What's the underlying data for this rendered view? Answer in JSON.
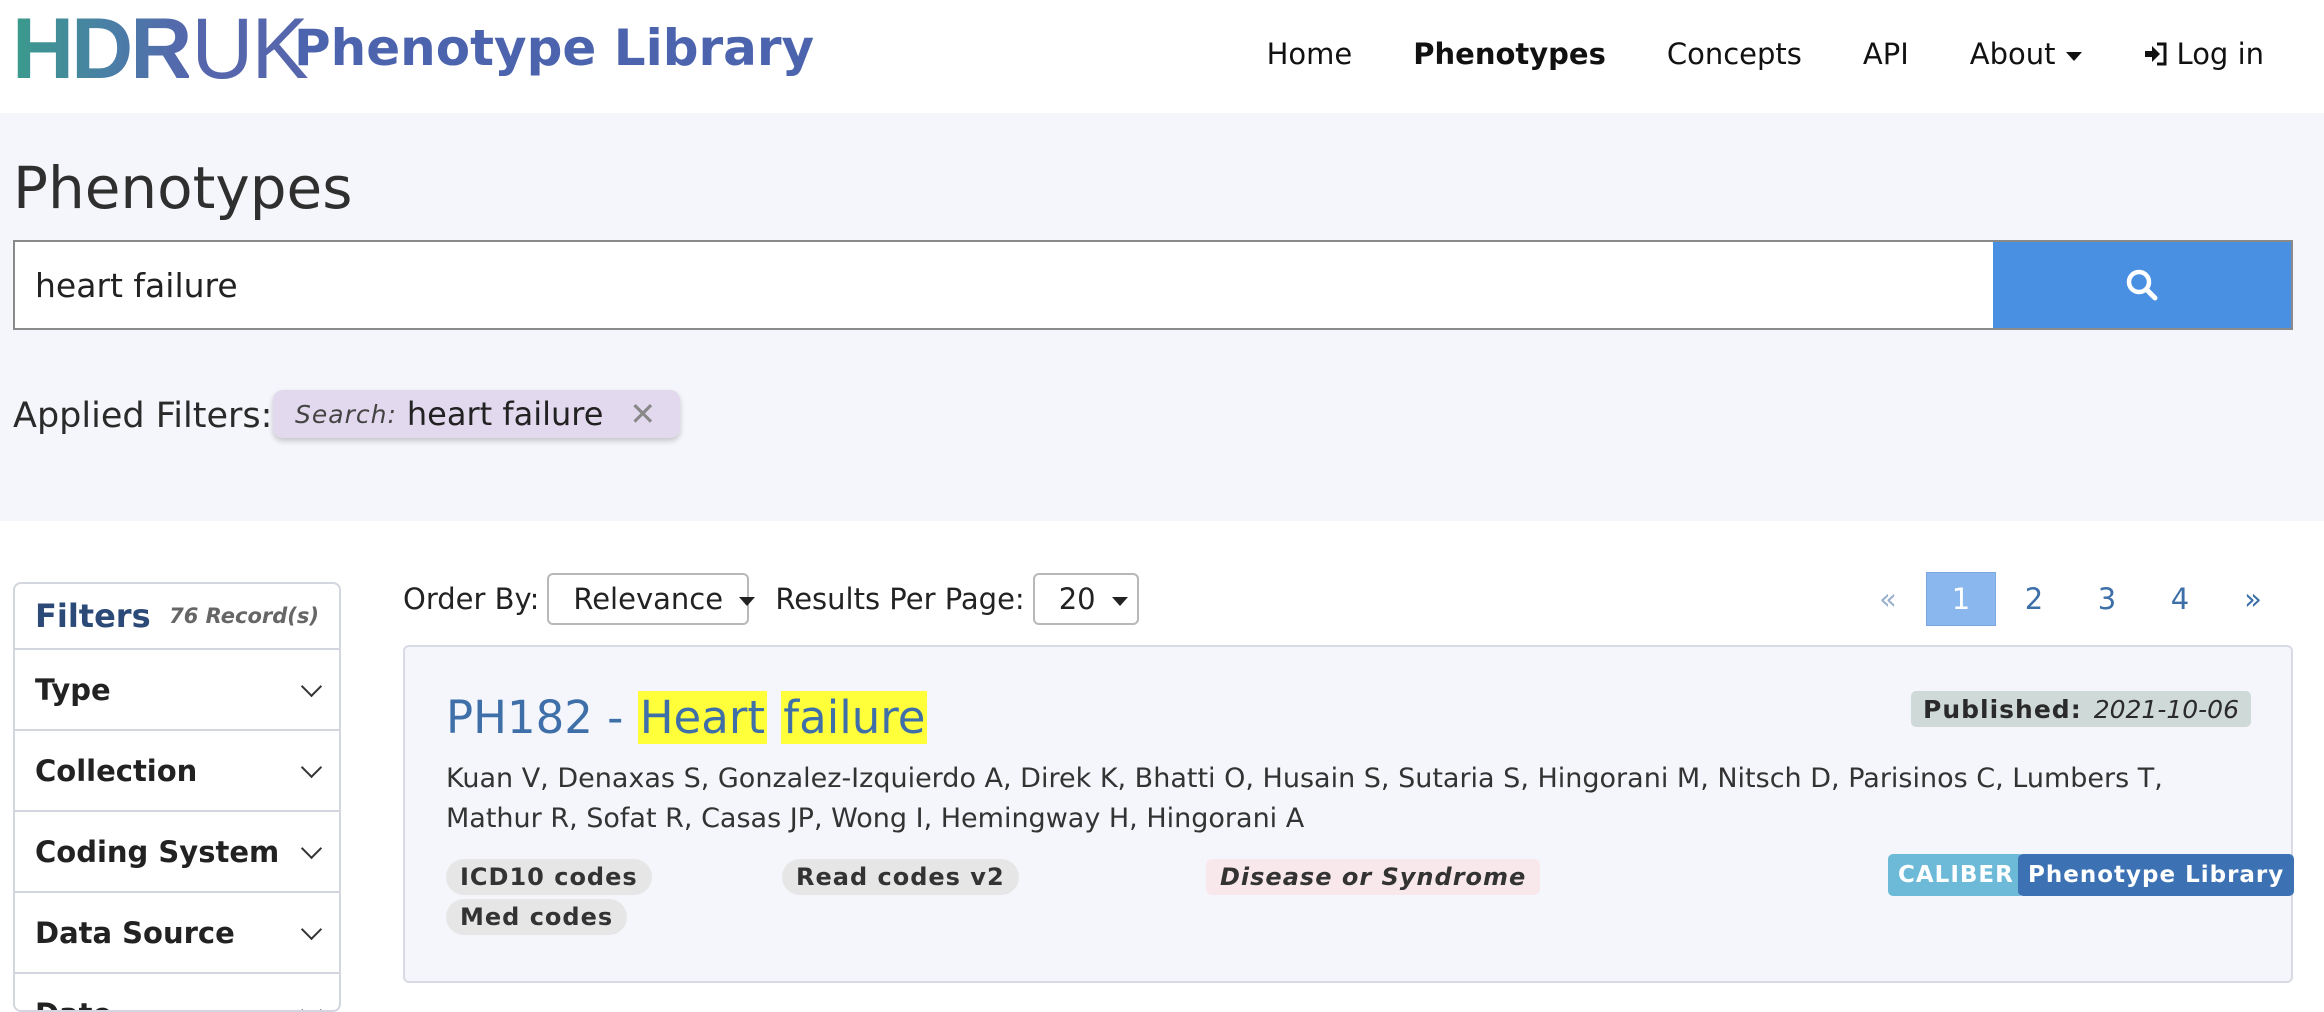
{
  "brand": {
    "logo_hdr": "HDR",
    "logo_uk": "UK",
    "site_title": "Phenotype Library"
  },
  "nav": {
    "home": "Home",
    "phenotypes": "Phenotypes",
    "concepts": "Concepts",
    "api": "API",
    "about": "About",
    "login": "Log in"
  },
  "page": {
    "title": "Phenotypes"
  },
  "search": {
    "value": "heart failure"
  },
  "applied_filters": {
    "label": "Applied Filters:",
    "chip_key": "Search:",
    "chip_value": "heart failure",
    "chip_remove": "✕"
  },
  "filters": {
    "title": "Filters",
    "count": "76 Record(s)",
    "items": [
      "Type",
      "Collection",
      "Coding System",
      "Data Source",
      "Date"
    ]
  },
  "toolbar": {
    "order_label": "Order By:",
    "order_value": "Relevance",
    "per_page_label": "Results Per Page:",
    "per_page_value": "20"
  },
  "pagination": {
    "prev": "«",
    "pages": [
      "1",
      "2",
      "3",
      "4"
    ],
    "current": "1",
    "next": "»"
  },
  "result": {
    "title_prefix": "PH182 - ",
    "title_word1": "Heart",
    "title_word2": "failure",
    "published_label": "Published:",
    "published_date": "2021-10-06",
    "authors": "Kuan V, Denaxas S, Gonzalez-Izquierdo A, Direk K, Bhatti O, Husain S, Sutaria S, Hingorani M, Nitsch D, Parisinos C, Lumbers T, Mathur R, Sofat R, Casas JP, Wong I, Hemingway H, Hingorani A",
    "coding_tags": [
      "ICD10 codes",
      "Read codes v2",
      "Med codes"
    ],
    "type_tag": "Disease or Syndrome",
    "collections": [
      "CALIBER",
      "Phenotype Library"
    ]
  },
  "colors": {
    "brand_blue": "#4c63ad",
    "search_button": "#4a90e2",
    "highlight": "#ffff3a",
    "caliber_badge": "#6cbad8",
    "phenotype_library_badge": "#3c72b4",
    "link": "#3f6fa9"
  },
  "icons": {
    "search_button": "search-icon",
    "login": "sign-in-icon",
    "dropdown": "caret-down-icon",
    "filter_expand": "chevron-down-icon"
  }
}
